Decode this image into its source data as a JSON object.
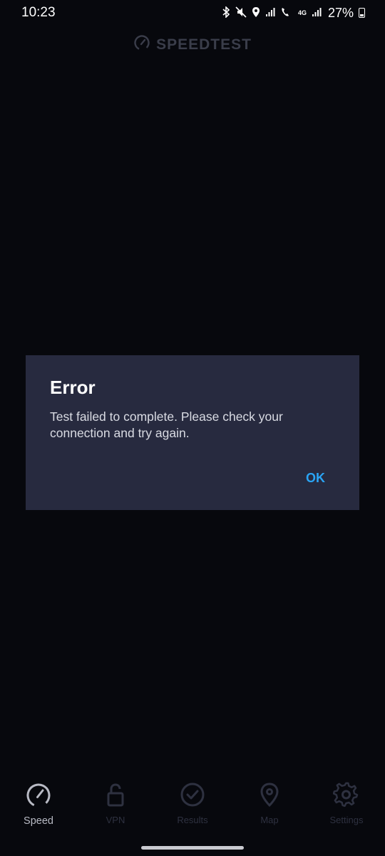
{
  "status_bar": {
    "time": "10:23",
    "network_label": "4G",
    "battery": "27%"
  },
  "app": {
    "logo_text": "SPEEDTEST"
  },
  "dialog": {
    "title": "Error",
    "message": "Test failed to complete. Please check your connection and try again.",
    "ok_label": "OK"
  },
  "nav": {
    "items": [
      {
        "label": "Speed",
        "icon": "speedometer-icon",
        "active": true
      },
      {
        "label": "VPN",
        "icon": "lock-icon",
        "active": false
      },
      {
        "label": "Results",
        "icon": "checkmark-circle-icon",
        "active": false
      },
      {
        "label": "Map",
        "icon": "map-pin-icon",
        "active": false
      },
      {
        "label": "Settings",
        "icon": "gear-icon",
        "active": false
      }
    ]
  },
  "colors": {
    "background": "#07080d",
    "dialog_bg": "#272a3f",
    "accent": "#2aa4f4",
    "inactive": "#2e3140"
  }
}
